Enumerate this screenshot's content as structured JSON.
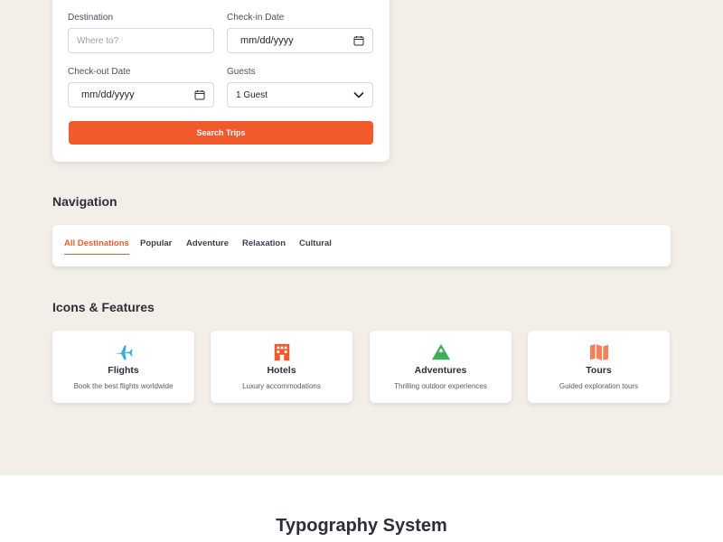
{
  "form": {
    "destination": {
      "label": "Destination",
      "placeholder": "Where to?"
    },
    "checkin": {
      "label": "Check-in Date",
      "value": "mm/dd/yyyy"
    },
    "checkout": {
      "label": "Check-out Date",
      "value": "mm/dd/yyyy"
    },
    "guests": {
      "label": "Guests",
      "value": "1 Guest"
    },
    "search_label": "Search Trips",
    "accent": "#f15a2c"
  },
  "navigation": {
    "title": "Navigation",
    "tabs": [
      {
        "label": "All Destinations",
        "active": true
      },
      {
        "label": "Popular",
        "active": false
      },
      {
        "label": "Adventure",
        "active": false
      },
      {
        "label": "Relaxation",
        "active": false
      },
      {
        "label": "Cultural",
        "active": false
      }
    ]
  },
  "features": {
    "title": "Icons & Features",
    "items": [
      {
        "icon": "airplane-icon",
        "title": "Flights",
        "description": "Book the best flights worldwide",
        "color": "#3aaed8"
      },
      {
        "icon": "hotel-icon",
        "title": "Hotels",
        "description": "Luxury accommodations",
        "color": "#f15a2c"
      },
      {
        "icon": "mountain-icon",
        "title": "Adventures",
        "description": "Thrilling outdoor experiences",
        "color": "#3fae5a"
      },
      {
        "icon": "map-icon",
        "title": "Tours",
        "description": "Guided exploration tours",
        "color": "#f3805a"
      }
    ]
  },
  "typography": {
    "title": "Typography System"
  }
}
